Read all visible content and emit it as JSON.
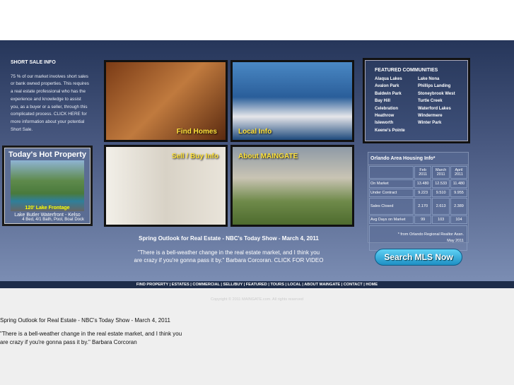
{
  "sidebar": {
    "title": "SHORT SALE INFO",
    "text": "75 % of our market involves short sales or bank owned properties. This requires a real estate professional who has the experience and knowledge to assist you, as a buyer or a seller, through this complicated process. CLICK HERE for more information about your potential Short Sale."
  },
  "hot": {
    "title": "Today's Hot Property",
    "photo_label": "120' Lake Frontage",
    "name": "Lake Butler Waterfront - Kelso",
    "details": "4 Bed, 4/1 Bath, Pool, Boat Dock"
  },
  "tiles": [
    "Find Homes",
    "Local Info",
    "Sell / Buy Info",
    "About MAINGATE"
  ],
  "featured": {
    "title": "FEATURED COMMUNITIES",
    "items": [
      "Alaqua Lakes",
      "Lake Nona",
      "Avalon Park",
      "Phillips Landing",
      "Baldwin Park",
      "Stoneybrook West",
      "Bay Hill",
      "Turtle Creek",
      "Celebration",
      "Waterford Lakes",
      "Heathrow",
      "Windermere",
      "Isleworth",
      "Winter Park",
      "Keene's Pointe"
    ]
  },
  "housing": {
    "title": "Orlando Area Housing Info*",
    "headers": [
      [
        "Feb",
        "2011"
      ],
      [
        "March",
        "2011"
      ],
      [
        "April",
        "2011"
      ]
    ],
    "rows": [
      {
        "label": "On Market",
        "values": [
          "13.480",
          "12.533",
          "11.480"
        ]
      },
      {
        "label": "Under Contract",
        "values": [
          "9.223",
          "9.510",
          "9.955"
        ]
      },
      {
        "label": "Sales Closed",
        "values": [
          "2.170",
          "2.613",
          "2.389"
        ]
      },
      {
        "label": "Avg Days on Market",
        "values": [
          "99",
          "103",
          "104"
        ]
      }
    ],
    "note1": "* from Orlando Regional Realtor Assn.",
    "note2": "May 2011"
  },
  "video": {
    "title": "Spring Outlook for Real Estate - NBC's Today Show - March 4, 2011",
    "quote1": "\"There is a bell-weather change in the real estate market, and I think you",
    "quote2": "are crazy if you're gonna pass it by.\" Barbara Corcoran. CLICK FOR VIDEO"
  },
  "mls_button": "Search MLS Now",
  "nav": "FIND PROPERTY | ESTATES | COMMERCIAL | SELL/BUY | FEATURED  | TOURS  | LOCAL | ABOUT MAINGATE | CONTACT | HOME",
  "copyright": "Copyright © 2011  MAINGATE.com. All rights reserved",
  "lower": {
    "title": "Spring Outlook for Real Estate - NBC's Today Show - March 4, 2011",
    "quote1": "\"There is a bell-weather change in the real estate market, and I think you",
    "quote2": "are crazy if you're gonna pass it by.\" Barbara Corcoran"
  }
}
